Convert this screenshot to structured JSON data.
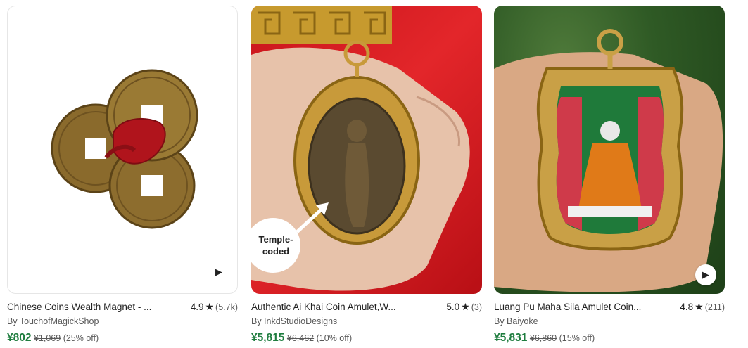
{
  "products": [
    {
      "title": "Chinese Coins Wealth Magnet - ...",
      "rating": "4.9",
      "reviews": "(5.7k)",
      "seller": "By TouchofMagickShop",
      "price": "¥802",
      "original_price": "¥1,069",
      "discount": "(25% off)",
      "has_video": true
    },
    {
      "title": "Authentic Ai Khai Coin Amulet,W...",
      "rating": "5.0",
      "reviews": "(3)",
      "seller": "By InkdStudioDesigns",
      "price": "¥5,815",
      "original_price": "¥6,462",
      "discount": "(10% off)",
      "callout": "Temple-coded"
    },
    {
      "title": "Luang Pu Maha Sila Amulet Coin...",
      "rating": "4.8",
      "reviews": "(211)",
      "seller": "By Baiyoke",
      "price": "¥5,831",
      "original_price": "¥6,860",
      "discount": "(15% off)",
      "has_video": true
    }
  ],
  "icons": {
    "star": "star-icon",
    "play": "play-icon"
  },
  "colors": {
    "price": "#1f7d3f",
    "thumb2_bg": "#d81e24",
    "thumb3_bg": "#2f5a25"
  }
}
